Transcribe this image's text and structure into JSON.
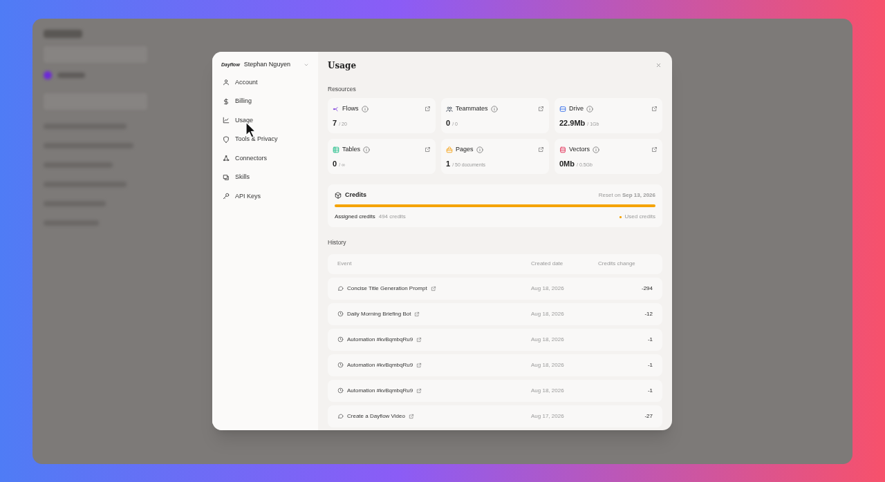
{
  "sidebar": {
    "user": {
      "logo": "Dayflow",
      "name": "Stephan Nguyen"
    },
    "items": [
      {
        "label": "Account"
      },
      {
        "label": "Billing"
      },
      {
        "label": "Usage"
      },
      {
        "label": "Tools & Privacy"
      },
      {
        "label": "Connectors"
      },
      {
        "label": "Skills"
      },
      {
        "label": "API Keys"
      }
    ]
  },
  "title": "Usage",
  "resources": {
    "heading": "Resources",
    "cards": [
      {
        "label": "Flows",
        "value": "7",
        "limit": "/ 20"
      },
      {
        "label": "Teammates",
        "value": "0",
        "limit": "/ 0"
      },
      {
        "label": "Drive",
        "value": "22.9Mb",
        "limit": "/ 1Gb"
      },
      {
        "label": "Tables",
        "value": "0",
        "limit": "/ ∞"
      },
      {
        "label": "Pages",
        "value": "1",
        "limit": "/ 50 documents"
      },
      {
        "label": "Vectors",
        "value": "0Mb",
        "limit": "/ 0.5Gb"
      }
    ]
  },
  "credits": {
    "title": "Credits",
    "reset": "Reset on **Sep 13, 2026**",
    "level": 1,
    "assigned_label": "Assigned credits",
    "assigned_value": "494 credits",
    "legend": "Used credits"
  },
  "history": {
    "heading": "History",
    "columns": [
      "Event",
      "Created date",
      "Credits change"
    ],
    "rows": [
      {
        "kind": "chat",
        "event": "Concise Title Generation Prompt",
        "date": "Aug 18, 2026",
        "change": "-294"
      },
      {
        "kind": "clock",
        "event": "Daily Morning Briefing Bot",
        "date": "Aug 18, 2026",
        "change": "-12"
      },
      {
        "kind": "clock",
        "event": "Automation #kvBqmbqRu9",
        "date": "Aug 18, 2026",
        "change": "-1"
      },
      {
        "kind": "clock",
        "event": "Automation #kvBqmbqRu9",
        "date": "Aug 18, 2026",
        "change": "-1"
      },
      {
        "kind": "clock",
        "event": "Automation #kvBqmbqRu9",
        "date": "Aug 18, 2026",
        "change": "-1"
      },
      {
        "kind": "chat",
        "event": "Create a Dayflow Video",
        "date": "Aug 17, 2026",
        "change": "-27"
      }
    ]
  }
}
